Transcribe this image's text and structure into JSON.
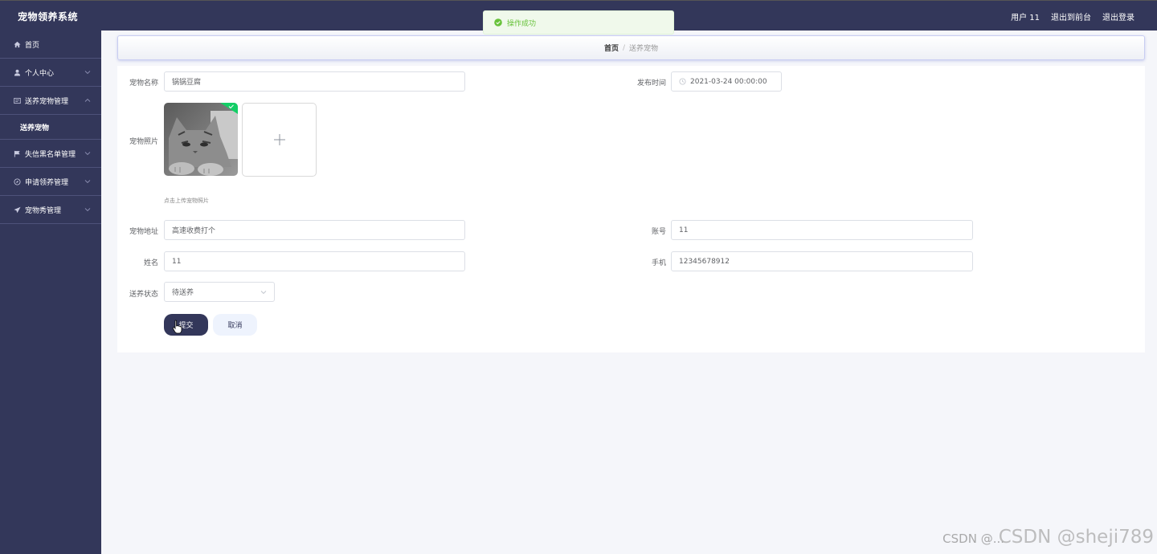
{
  "app": {
    "title": "宠物领养系统"
  },
  "header": {
    "user_label": "用户 11",
    "front_link": "退出到前台",
    "logout_link": "退出登录"
  },
  "sidebar": {
    "items": [
      {
        "label": "首页",
        "icon": "home-icon"
      },
      {
        "label": "个人中心",
        "icon": "user-icon"
      },
      {
        "label": "送养宠物管理",
        "icon": "list-icon"
      },
      {
        "label": "送养宠物",
        "sub": true
      },
      {
        "label": "失信黑名单管理",
        "icon": "flag-icon"
      },
      {
        "label": "申请领养管理",
        "icon": "compass-icon"
      },
      {
        "label": "宠物秀管理",
        "icon": "send-icon"
      }
    ]
  },
  "toast": {
    "message": "操作成功"
  },
  "breadcrumb": {
    "home": "首页",
    "separator": "/",
    "current": "送养宠物"
  },
  "form": {
    "pet_name_label": "宠物名称",
    "pet_name_value": "锅锅豆腐",
    "publish_time_label": "发布时间",
    "publish_time_value": "2021-03-24 00:00:00",
    "pet_photo_label": "宠物照片",
    "upload_hint": "点击上传宠物照片",
    "pet_address_label": "宠物地址",
    "pet_address_value": "高速收费打个",
    "account_label": "账号",
    "account_value": "11",
    "name_label": "姓名",
    "name_value": "11",
    "phone_label": "手机",
    "phone_value": "12345678912",
    "status_label": "送养状态",
    "status_value": "待送养",
    "submit_label": "提交",
    "cancel_label": "取消"
  },
  "watermark": {
    "text": "CSDN @sheji789",
    "small": "CSDN @..."
  },
  "colors": {
    "nav_bg": "#33375a",
    "success": "#67c23a",
    "upload_ok": "#13ce66"
  }
}
